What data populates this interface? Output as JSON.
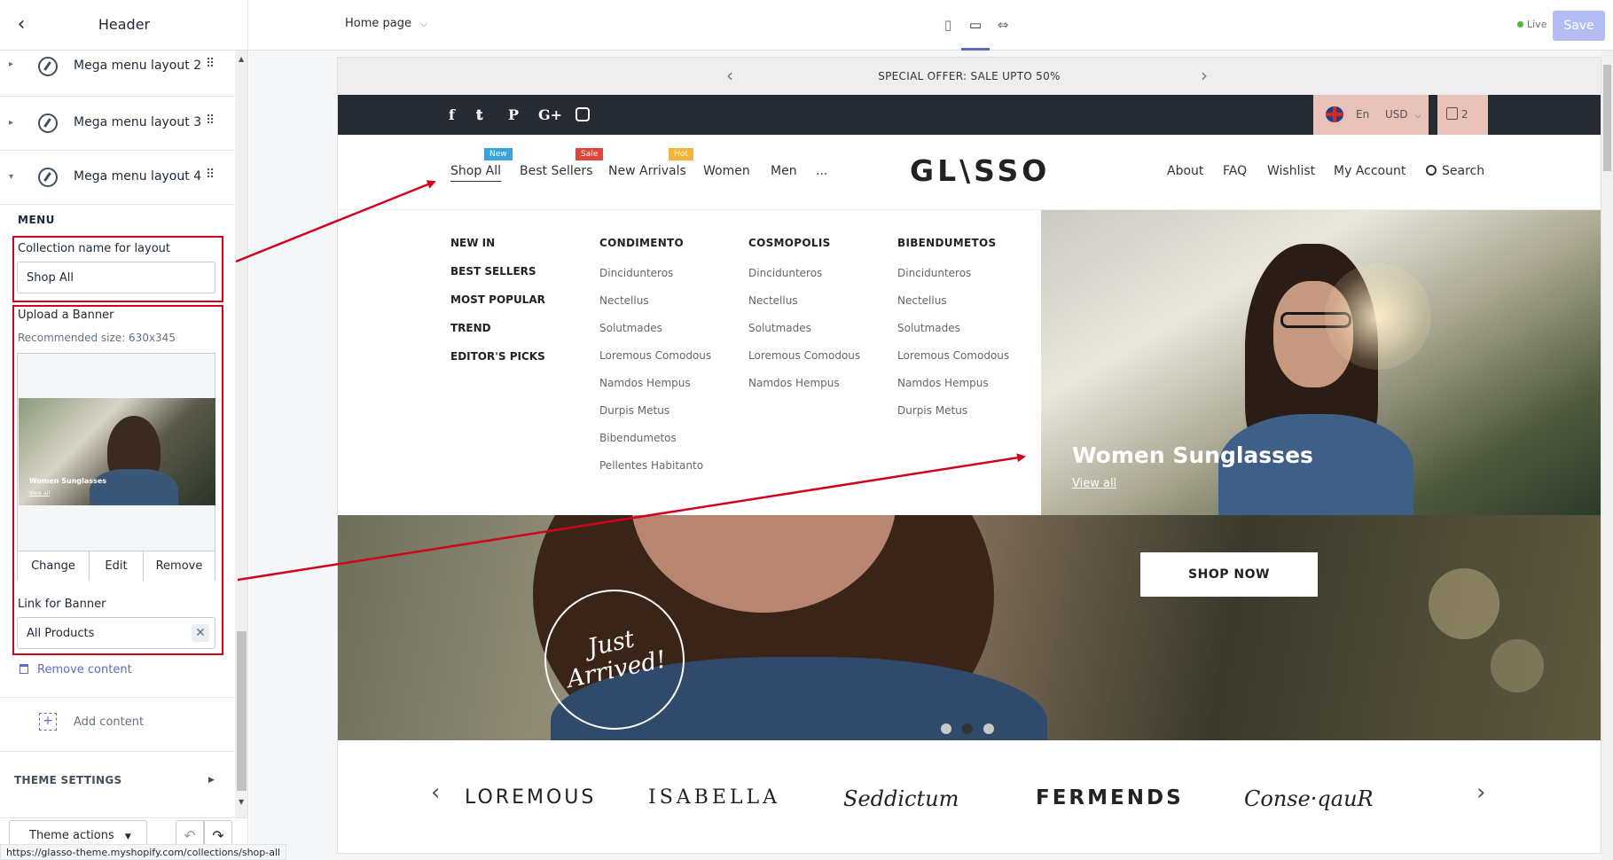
{
  "sidebar": {
    "title": "Header",
    "sections": [
      {
        "label": "Mega menu layout 2"
      },
      {
        "label": "Mega menu layout 3"
      },
      {
        "label": "Mega menu layout 4"
      }
    ],
    "menu_heading": "MENU",
    "collection_label": "Collection name for layout",
    "collection_value": "Shop All",
    "upload_label": "Upload a Banner",
    "recommended": "Recommended size: 630x345",
    "thumb_title": "Women Sunglasses",
    "thumb_link": "View all",
    "banner_actions": {
      "change": "Change",
      "edit": "Edit",
      "remove": "Remove"
    },
    "link_label": "Link for Banner",
    "link_value": "All Products",
    "remove_content": "Remove content",
    "add_content": "Add content",
    "theme_settings": "THEME SETTINGS",
    "theme_actions": "Theme actions",
    "status_url": "https://glasso-theme.myshopify.com/collections/shop-all"
  },
  "topbar": {
    "page": "Home page",
    "live": "Live",
    "save": "Save"
  },
  "preview": {
    "announcement": "SPECIAL OFFER: SALE UPTO 50%",
    "language": "En",
    "currency": "USD",
    "cart_count": "2",
    "logo": "GL\\SSO",
    "nav_left": [
      {
        "label": "Shop All",
        "badge": "New",
        "badge_color": "#3ba2dc"
      },
      {
        "label": "Best Sellers",
        "badge": "Sale",
        "badge_color": "#e0463a"
      },
      {
        "label": "New Arrivals",
        "badge": "Hot",
        "badge_color": "#f4b23e"
      },
      {
        "label": "Women"
      },
      {
        "label": "Men"
      },
      {
        "label": "..."
      }
    ],
    "nav_right": [
      "About",
      "FAQ",
      "Wishlist",
      "My Account",
      "Search"
    ],
    "mega": {
      "col1": [
        "NEW IN",
        "BEST SELLERS",
        "MOST POPULAR",
        "TREND",
        "EDITOR'S PICKS"
      ],
      "col2": {
        "heading": "CONDIMENTO",
        "items": [
          "Dincidunteros",
          "Nectellus",
          "Solutmades",
          "Loremous Comodous",
          "Namdos Hempus",
          "Durpis Metus",
          "Bibendumetos",
          "Pellentes Habitanto"
        ]
      },
      "col3": {
        "heading": "COSMOPOLIS",
        "items": [
          "Dincidunteros",
          "Nectellus",
          "Solutmades",
          "Loremous Comodous",
          "Namdos Hempus"
        ]
      },
      "col4": {
        "heading": "BIBENDUMETOS",
        "items": [
          "Dincidunteros",
          "Nectellus",
          "Solutmades",
          "Loremous Comodous",
          "Namdos Hempus",
          "Durpis Metus"
        ]
      },
      "banner_title": "Women Sunglasses",
      "banner_link": "View all"
    },
    "hero": {
      "button": "SHOP NOW",
      "stamp_line1": "Just",
      "stamp_line2": "Arrived!"
    },
    "brands": [
      "LOREMOUS",
      "ISABELLA",
      "Seddictum",
      "FERMENDS",
      "Conse·qauR"
    ]
  }
}
